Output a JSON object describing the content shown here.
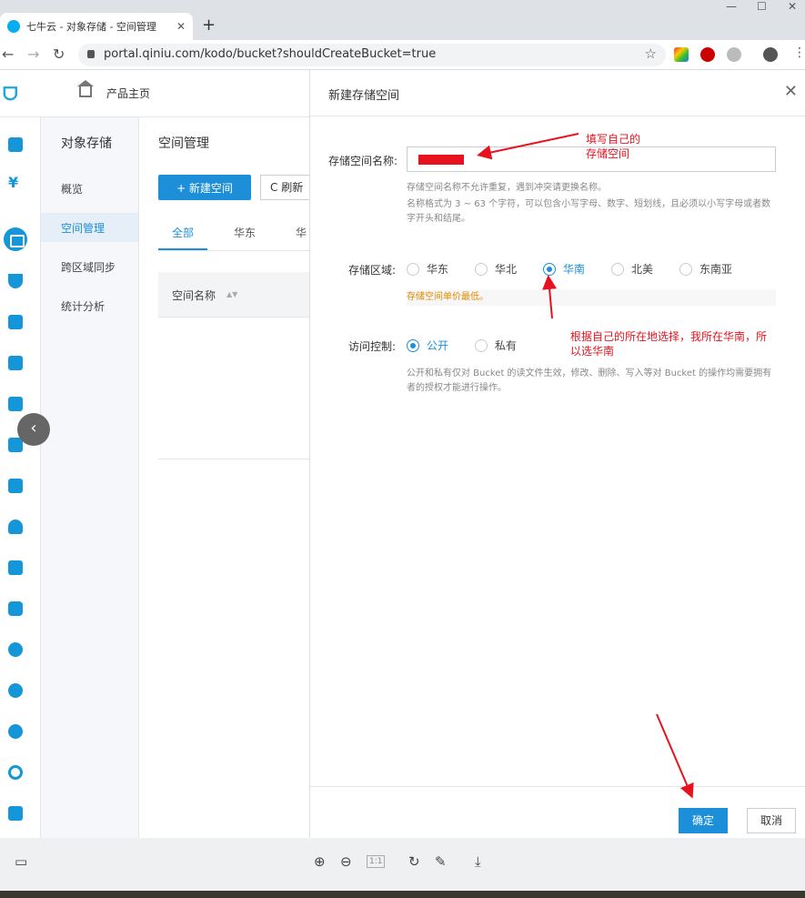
{
  "browser": {
    "tab_title": "七牛云 - 对象存储 - 空间管理",
    "tab_close": "✕",
    "new_tab": "+",
    "window_controls": {
      "minimize": "—",
      "maximize": "☐",
      "close": "✕"
    },
    "url": "portal.qiniu.com/kodo/bucket?shouldCreateBucket=true",
    "nav": {
      "back": "←",
      "forward": "→",
      "reload": "↻"
    },
    "star": "☆",
    "menu": "⋮"
  },
  "topbar": {
    "home_label": "产品主页"
  },
  "submenu": {
    "title": "对象存储",
    "items": [
      "概览",
      "空间管理",
      "跨区域同步",
      "统计分析"
    ],
    "selected": "空间管理"
  },
  "main": {
    "title": "空间管理",
    "new_button": "+ 新建空间",
    "refresh_button": "C 刷新",
    "tabs": [
      "全部",
      "华东",
      "华"
    ],
    "column_header": "空间名称",
    "sort_icon": "▲▼"
  },
  "dialog": {
    "title": "新建存储空间",
    "close": "✕",
    "name_label": "存储空间名称:",
    "name_help_1": "存储空间名称不允许重复，遇到冲突请更换名称。",
    "name_help_2": "名称格式为 3 ~ 63 个字符，可以包含小写字母、数字、短划线，且必须以小写字母或者数字开头和结尾。",
    "region_label": "存储区域:",
    "regions": [
      "华东",
      "华北",
      "华南",
      "北美",
      "东南亚"
    ],
    "region_selected": "华南",
    "price_note": "存储空间单价最低。",
    "access_label": "访问控制:",
    "access_options": [
      "公开",
      "私有"
    ],
    "access_selected": "公开",
    "access_help": "公开和私有仅对 Bucket 的读文件生效，修改、删除、写入等对 Bucket 的操作均需要拥有者的授权才能进行操作。",
    "ok": "确定",
    "cancel": "取消"
  },
  "annotations": {
    "fill_name_1": "填写自己的",
    "fill_name_2": "存储空间",
    "region_note_1": "根据自己的所在地选择，我所在华南，所",
    "region_note_2": "以选华南"
  },
  "viewer": {
    "page_indicator": "1:1"
  },
  "colors": {
    "accent": "#1c8fd8",
    "annotation": "#e8121f",
    "price_note": "#e08a00"
  }
}
